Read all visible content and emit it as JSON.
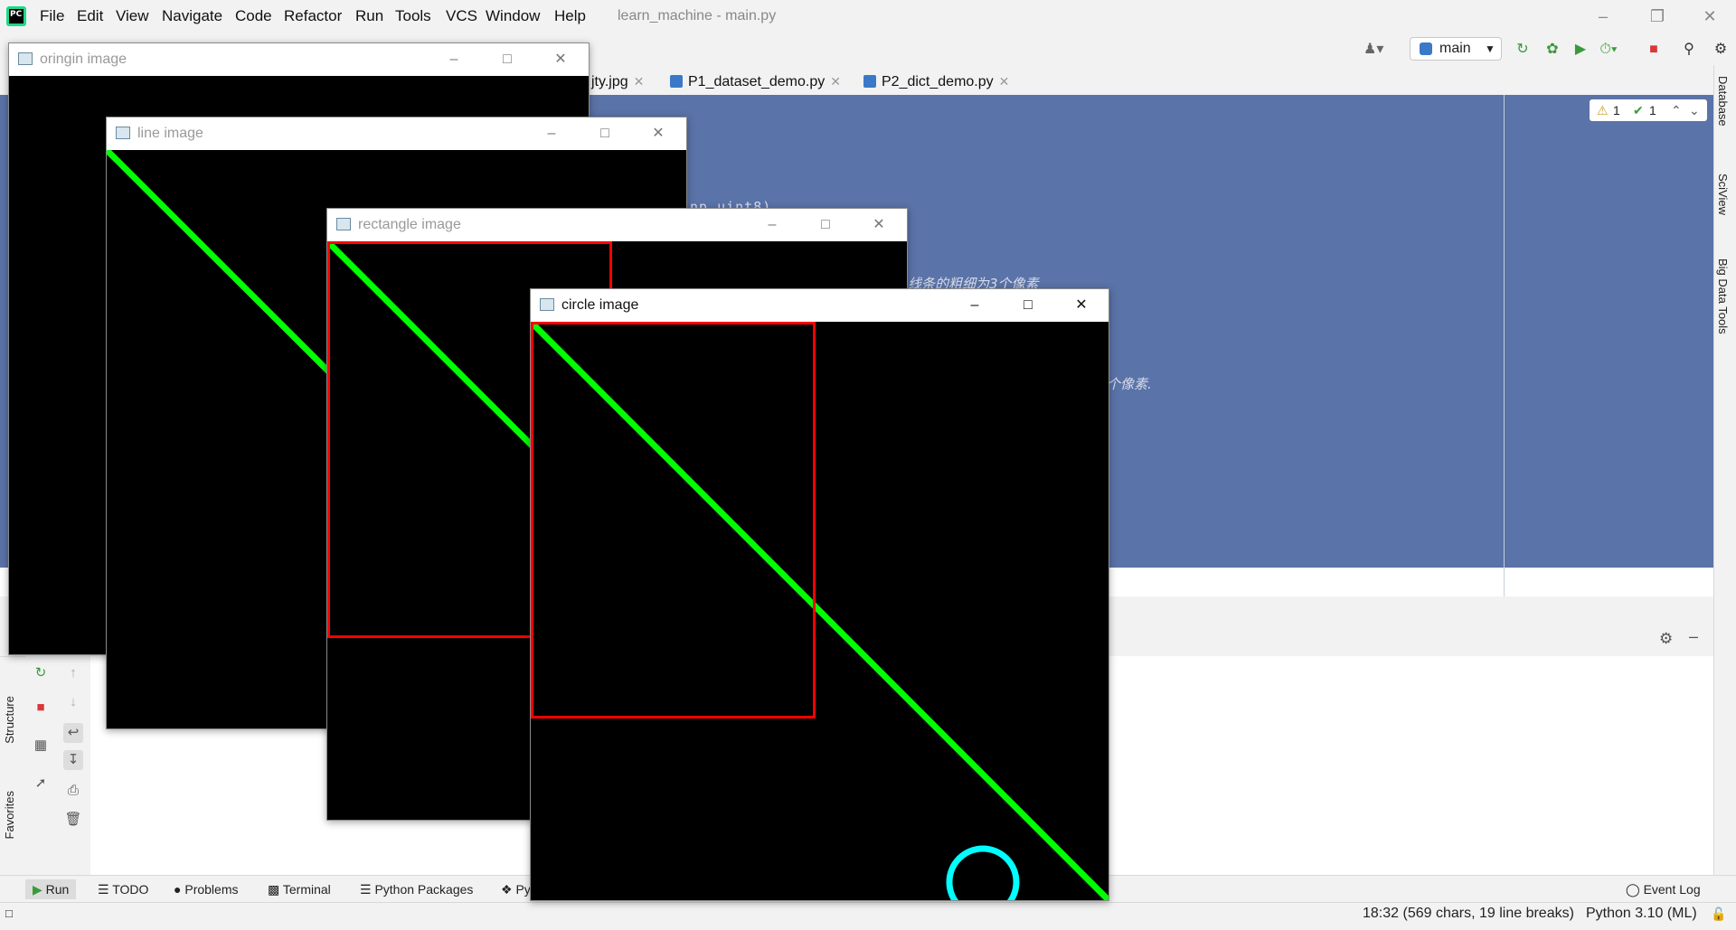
{
  "menubar": {
    "items": [
      "File",
      "Edit",
      "View",
      "Navigate",
      "Code",
      "Refactor",
      "Run",
      "Tools",
      "VCS",
      "Window",
      "Help"
    ],
    "window_title": "learn_machine - main.py"
  },
  "toolbar": {
    "run_config": "main"
  },
  "tabs": [
    {
      "label": "jty.jpg"
    },
    {
      "label": "P1_dataset_demo.py"
    },
    {
      "label": "P2_dict_demo.py"
    }
  ],
  "editor": {
    "fragments": [
      "np.uint8)",
      "线条的粗细为3个像素",
      "个像素."
    ],
    "inspection": {
      "warnings": "1",
      "weak_warnings": "1"
    }
  },
  "right_strip": [
    "Database",
    "SciView",
    "Big Data Tools"
  ],
  "left_strip": [
    "Structure",
    "Favorites"
  ],
  "bottom_tools": [
    "Run",
    "TODO",
    "Problems",
    "Terminal",
    "Python Packages",
    "Py"
  ],
  "event_log": "Event Log",
  "status": {
    "position": "18:32 (569 chars, 19 line breaks)",
    "interpreter": "Python 3.10 (ML)"
  },
  "cv_windows": {
    "origin": {
      "title": "oringin image"
    },
    "line": {
      "title": "line image"
    },
    "rectangle": {
      "title": "rectangle image"
    },
    "circle": {
      "title": "circle image"
    }
  },
  "colors": {
    "line": "#00ff00",
    "rectangle": "#ff0000",
    "circle": "#00ffff",
    "editor_bg": "#5a73a8"
  },
  "icons": {
    "run": "run-icon",
    "debug": "debug-icon",
    "stop": "stop-icon",
    "search": "search-icon",
    "settings": "gear-icon"
  }
}
